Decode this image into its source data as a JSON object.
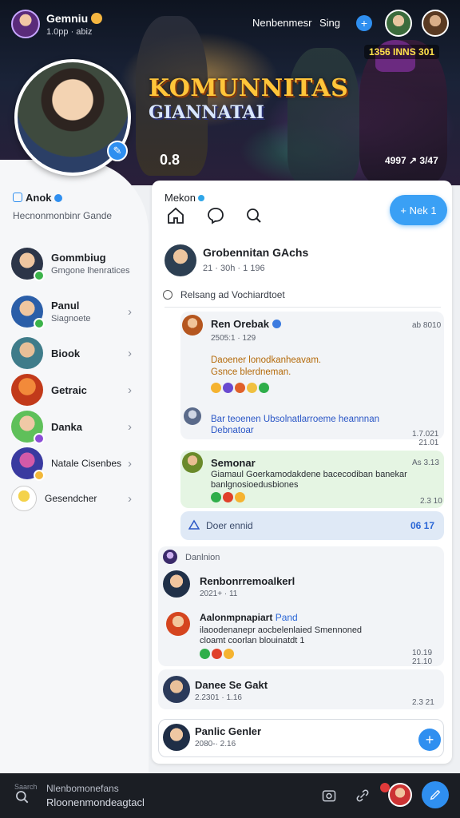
{
  "topbar": {
    "user_name": "Gemniu",
    "user_sub": "1.0pp · abiz",
    "link1": "Nenbenmesr",
    "link2": "Sing",
    "plus": "+"
  },
  "hero": {
    "title": "KOMUNNITAS",
    "subtitle": "GIANNATAI",
    "count_left": "0.8",
    "count_right": "4997 ↗ 3/47",
    "tag": "1356 INNS 301"
  },
  "profile": {
    "name": "Anok",
    "subtitle": "Hecnonmonbinr Gande"
  },
  "friends": [
    {
      "name": "Gommbiug",
      "sub": "Gmgone lhenratices",
      "chevron": false
    },
    {
      "name": "Panul",
      "sub": "Siagnoete",
      "chevron": true
    },
    {
      "name": "Biook",
      "sub": "",
      "chevron": true
    },
    {
      "name": "Getraic",
      "sub": "",
      "chevron": true
    },
    {
      "name": "Danka",
      "sub": "",
      "chevron": true
    },
    {
      "name": "Natale Cisenbes",
      "sub": "",
      "chevron": true
    },
    {
      "name": "Gesendcher",
      "sub": "",
      "chevron": true
    }
  ],
  "feed": {
    "header_label": "Mekon",
    "new_button": "+ Nek 1",
    "group_title": "Grobennitan GAchs",
    "group_meta": "21 · 30h · 1 196",
    "radio_label": "Relsang ad Vochiardtoet",
    "messages": {
      "m1": {
        "name": "Ren Orebak",
        "time": "ab 8010",
        "meta": "2505:1 · 129",
        "line1": "Daoener lonodkanheavam.",
        "line2": "Gsnce blerdneman.",
        "line3": "Bar teoenen Ubsolnatlarroeme heannnan",
        "line4": "Debnatoar",
        "foot": "1.7.021\n21.01"
      },
      "m2": {
        "name": "Semonar",
        "time": "As 3.13",
        "line1": "Giamaul Goerkamodakdene bacecodiban banekar",
        "line2": "banlgnosioedusbiones",
        "foot": "2.3 10"
      },
      "m3": {
        "text": "Doer ennid",
        "badge": "06 17"
      },
      "m4": {
        "section": "Danlnion",
        "name": "Renbonrremoalkerl",
        "meta": "2021+ · 11",
        "name2": "Aalonmpnapiart",
        "name2_tag": "Pand",
        "line1": "ilaoodenanepr aocbelenlaied Smennoned",
        "line2": "cloamt coorlan blouinatdt 1",
        "foot": "10.19\n21.10"
      },
      "m5": {
        "name": "Danee Se Gakt",
        "meta": "2.2301 · 1.16",
        "time": "2.3 21"
      },
      "m6": {
        "name": "Panlic Genler",
        "meta": "2080-· 2.16"
      }
    }
  },
  "bottom": {
    "hint": "Saarch",
    "line1": "Nlenbomonefans",
    "line2": "Rloonenmondeagtacl"
  }
}
